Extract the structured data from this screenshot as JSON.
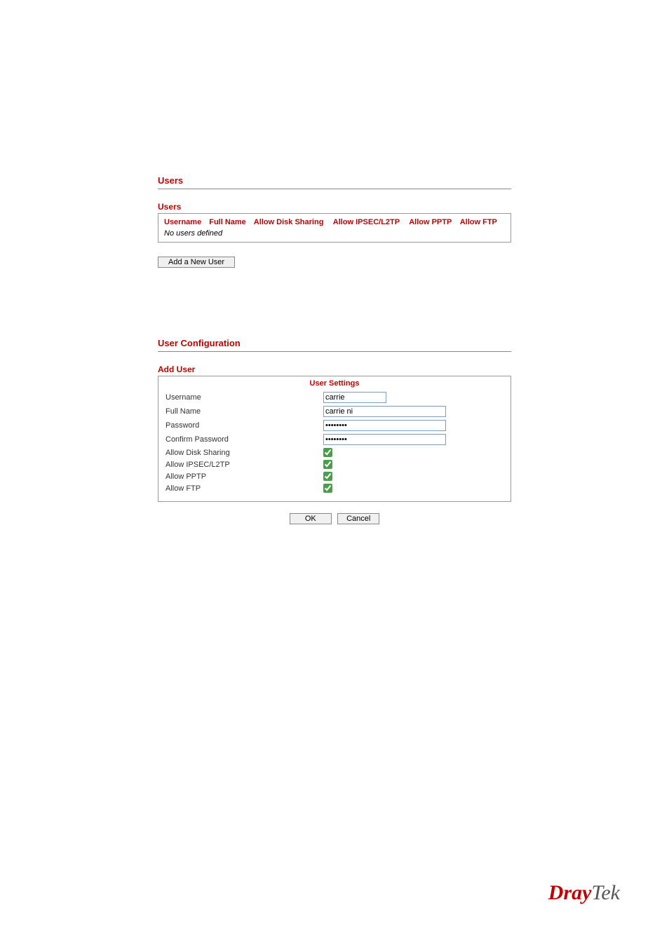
{
  "section1": {
    "title": "Users",
    "sub_title": "Users",
    "columns": {
      "username": "Username",
      "full_name": "Full Name",
      "disk": "Allow Disk Sharing",
      "ipsec": "Allow IPSEC/L2TP",
      "pptp": "Allow PPTP",
      "ftp": "Allow FTP"
    },
    "empty_text": "No users defined",
    "add_button": "Add a New User"
  },
  "section2": {
    "title": "User Configuration",
    "sub_title": "Add User",
    "box_title": "User Settings",
    "fields": {
      "username_label": "Username",
      "username_value": "carrie",
      "fullname_label": "Full Name",
      "fullname_value": "carrie ni",
      "password_label": "Password",
      "password_value": "••••••••",
      "confirm_label": "Confirm Password",
      "confirm_value": "••••••••",
      "disk_label": "Allow Disk Sharing",
      "ipsec_label": "Allow IPSEC/L2TP",
      "pptp_label": "Allow PPTP",
      "ftp_label": "Allow FTP"
    },
    "ok_button": "OK",
    "cancel_button": "Cancel"
  },
  "logo": {
    "part1": "Dray",
    "part2": "Tek"
  }
}
